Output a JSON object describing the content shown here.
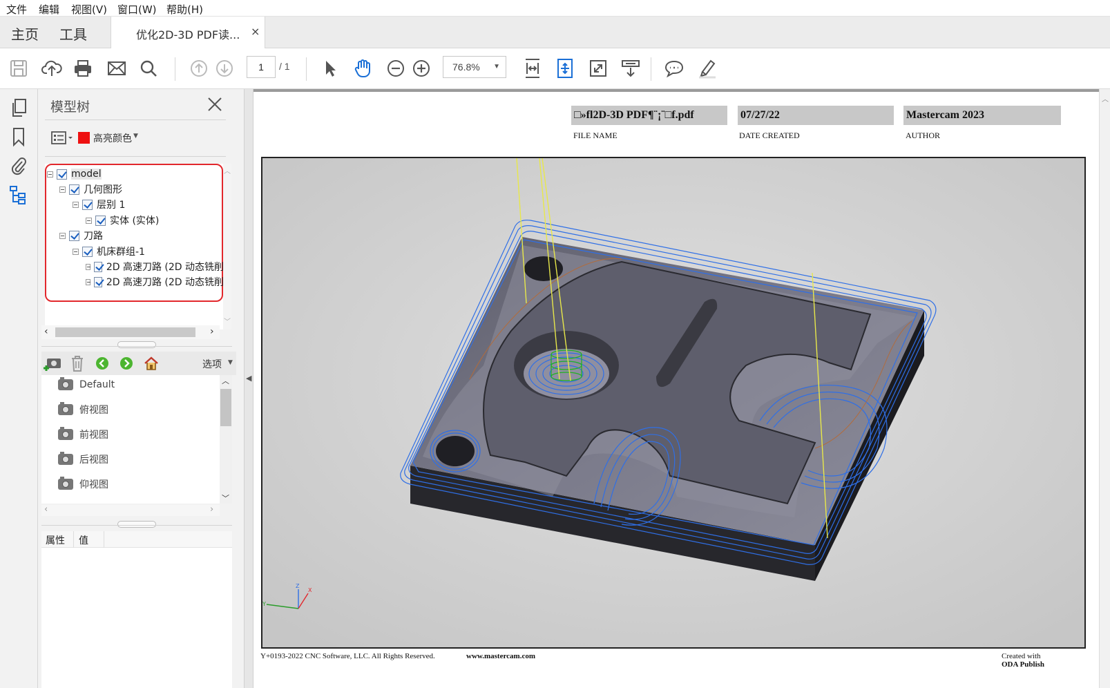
{
  "menubar": {
    "file": "文件",
    "edit": "编辑",
    "view": "视图(V)",
    "window": "窗口(W)",
    "help": "帮助(H)"
  },
  "tabs": {
    "home": "主页",
    "tools": "工具",
    "doc_title": "优化2D-3D PDF读...",
    "close": "×"
  },
  "toolbar": {
    "page_current": "1",
    "page_total": "/ 1",
    "zoom": "76.8%"
  },
  "panel": {
    "title": "模型树",
    "highlight_label": "高亮颜色",
    "highlight_color": "#ee1111",
    "tree": [
      {
        "label": "model",
        "level": 0
      },
      {
        "label": "几何图形",
        "level": 1
      },
      {
        "label": "层别 1",
        "level": 2
      },
      {
        "label": "实体 (实体)",
        "level": 3
      },
      {
        "label": "刀路",
        "level": 1
      },
      {
        "label": "机床群组-1",
        "level": 2
      },
      {
        "label": "2D 高速刀路 (2D 动态铣削",
        "level": 3
      },
      {
        "label": "2D 高速刀路 (2D 动态铣削",
        "level": 3
      }
    ],
    "options_label": "选项",
    "views": [
      "Default",
      "俯视图",
      "前视图",
      "后视图",
      "仰视图"
    ],
    "props_col1": "属性",
    "props_col2": "值"
  },
  "document": {
    "file_name_value": "□»fl2D-3D PDF¶¨¡¨□f.pdf",
    "date_value": "07/27/22",
    "author_value": "Mastercam 2023",
    "file_name_label": "FILE NAME",
    "date_label": "DATE CREATED",
    "author_label": "AUTHOR",
    "footer_copyright": "Y+0193-2022 CNC Software, LLC. All Rights Reserved.",
    "footer_url": "www.mastercam.com",
    "footer_created1": "Created with",
    "footer_created2": "ODA Publish",
    "axis_z": "Z",
    "axis_x": "X",
    "axis_y": "Y"
  },
  "colors": {
    "accent": "#1a6fd6",
    "highlight_border": "#e2272c",
    "toolpath": "#2f6fe6",
    "tool_line": "#e8e84a"
  }
}
